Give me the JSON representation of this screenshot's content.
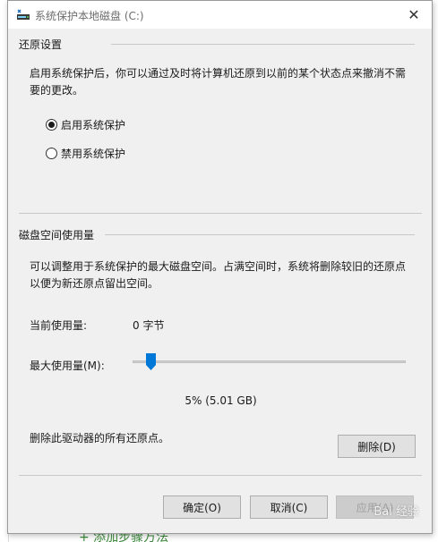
{
  "window": {
    "title": "系统保护本地磁盘 (C:)",
    "close_glyph": "✕"
  },
  "restore_settings": {
    "header": "还原设置",
    "description": "启用系统保护后，你可以通过及时将计算机还原到以前的某个状态点来撤消不需要的更改。",
    "options": [
      {
        "label": "启用系统保护",
        "checked": true
      },
      {
        "label": "禁用系统保护",
        "checked": false
      }
    ]
  },
  "disk_usage": {
    "header": "磁盘空间使用量",
    "description": "可以调整用于系统保护的最大磁盘空间。占满空间时，系统将删除较旧的还原点以便为新还原点留出空间。",
    "current_label": "当前使用量:",
    "current_value": "0 字节",
    "max_label": "最大使用量(M):",
    "max_value_text": "5% (5.01 GB)",
    "max_percent": 5,
    "delete_text": "删除此驱动器的所有还原点。",
    "delete_button": "删除(D)"
  },
  "footer": {
    "ok_button": "确定(O)",
    "cancel_button": "取消(C)",
    "apply_button": "应用(A)"
  },
  "watermark": "Bai 经验",
  "background": {
    "bottom_fragment": "+ 添加步骤方法"
  },
  "colors": {
    "accent": "#0078d7",
    "dialog_bg": "#f0f0f0"
  }
}
